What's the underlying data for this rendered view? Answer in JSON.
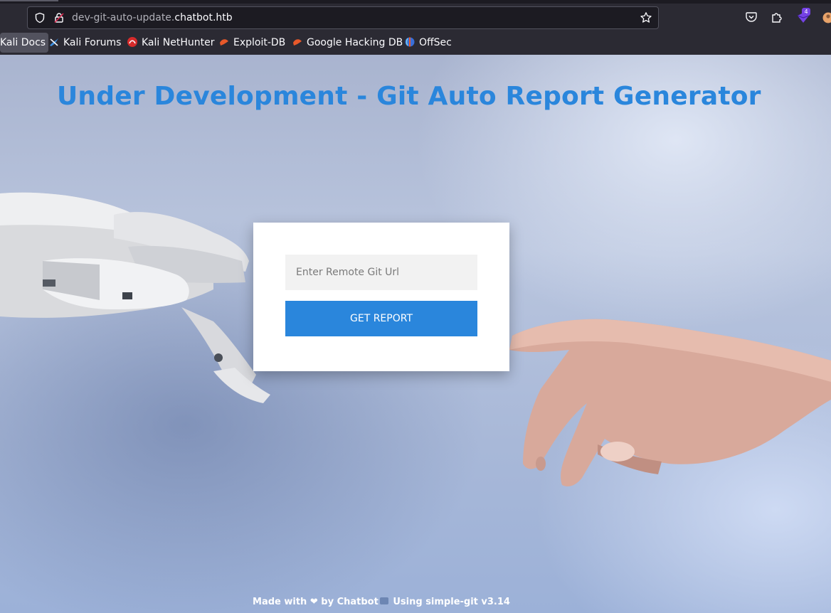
{
  "browser": {
    "url_path": "dev-git-auto-update.",
    "url_host": "chatbot.htb",
    "extension_badge": "4",
    "bookmarks": [
      {
        "label": "Kali Docs"
      },
      {
        "label": "Kali Forums"
      },
      {
        "label": "Kali NetHunter"
      },
      {
        "label": "Exploit-DB"
      },
      {
        "label": "Google Hacking DB"
      },
      {
        "label": "OffSec"
      }
    ]
  },
  "page": {
    "title": "Under Development - Git Auto Report Generator",
    "form": {
      "placeholder": "Enter Remote Git Url",
      "value": "",
      "button_label": "GET REPORT"
    },
    "footer": {
      "made_with": "Made with",
      "heart": "❤",
      "by": "by Chatbot",
      "using": "Using simple-git v3.14"
    }
  },
  "colors": {
    "accent": "#2a86dc",
    "chrome_bg": "#2b2a33",
    "card_bg": "#ffffff"
  }
}
